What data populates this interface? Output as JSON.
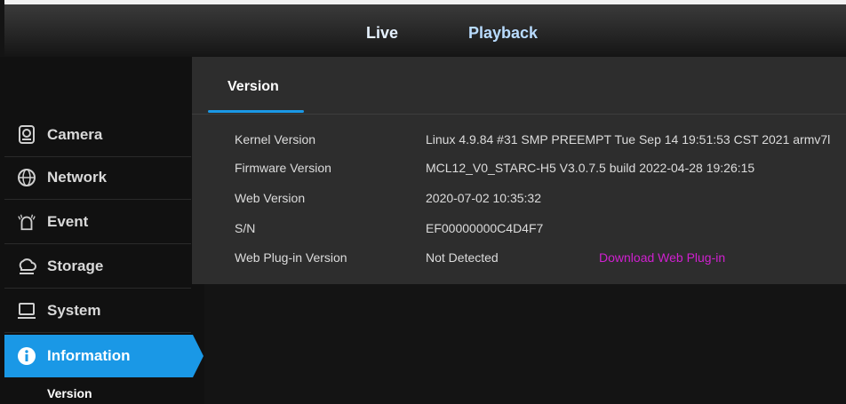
{
  "top_nav": {
    "tabs": [
      {
        "label": "Live"
      },
      {
        "label": "Playback"
      }
    ]
  },
  "sidebar": {
    "items": [
      {
        "label": "Camera",
        "icon": "camera-icon"
      },
      {
        "label": "Network",
        "icon": "network-icon"
      },
      {
        "label": "Event",
        "icon": "event-icon"
      },
      {
        "label": "Storage",
        "icon": "storage-icon"
      },
      {
        "label": "System",
        "icon": "system-icon"
      },
      {
        "label": "Information",
        "icon": "info-icon",
        "active": true
      }
    ],
    "sub_item": "Version"
  },
  "panel": {
    "tab_label": "Version",
    "rows": [
      {
        "key": "Kernel Version",
        "value": "Linux 4.9.84 #31 SMP PREEMPT Tue Sep 14 19:51:53 CST 2021 armv7l"
      },
      {
        "key": "Firmware Version",
        "value": "MCL12_V0_STARC-H5 V3.0.7.5 build 2022-04-28 19:26:15"
      },
      {
        "key": "Web Version",
        "value": "2020-07-02 10:35:32"
      },
      {
        "key": "S/N",
        "value": "EF00000000C4D4F7"
      },
      {
        "key": "Web Plug-in Version",
        "value": "Not Detected"
      }
    ],
    "download_link": "Download Web Plug-in"
  },
  "colors": {
    "accent": "#1a98e6",
    "link": "#d020d0",
    "panel_bg": "#2d2d2d",
    "page_bg": "#141414"
  }
}
